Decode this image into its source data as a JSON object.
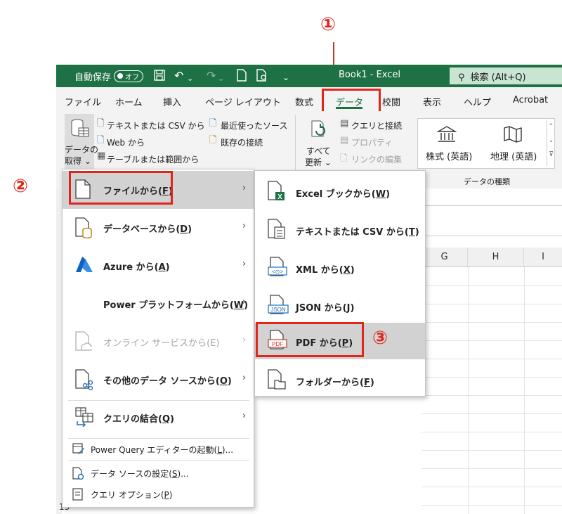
{
  "annotations": {
    "step1": "①",
    "step2": "②",
    "step3": "③"
  },
  "titlebar": {
    "autosave_label": "自動保存",
    "autosave_state": "オフ",
    "undo_icon": "↶",
    "redo_icon": "↷",
    "dropdown_glyph": "⌄",
    "book_title": "Book1  -  Excel",
    "search_text": "検索 (Alt+Q)"
  },
  "tabs": [
    "ファイル",
    "ホーム",
    "挿入",
    "ページ レイアウト",
    "数式",
    "データ",
    "校閲",
    "表示",
    "ヘルプ",
    "Acrobat"
  ],
  "ribbon": {
    "get_data_line1": "データの",
    "get_data_line2": "取得 ⌄",
    "text_csv": "テキストまたは CSV から",
    "web": "Web から",
    "table_range": "テーブルまたは範囲から",
    "recent_sources": "最近使ったソース",
    "existing_conn": "既存の接続",
    "refresh_line1": "すべて",
    "refresh_line2": "更新 ⌄",
    "queries_conn": "クエリと接続",
    "properties": "プロパティ",
    "edit_links": "リンクの編集",
    "stocks": "株式 (英語)",
    "geography": "地理 (英語)",
    "data_types_group": "データの種類"
  },
  "columns": [
    "G",
    "H",
    "I"
  ],
  "row_number": "13",
  "menu_left": {
    "from_file": "ファイルから(",
    "from_file_key": "F",
    "from_database": "データベースから(",
    "from_database_key": "D",
    "from_azure": "Azure から(",
    "from_azure_key": "A",
    "from_power_platform": "Power プラットフォームから(",
    "from_power_platform_key": "W",
    "from_online": "オンライン サービスから(E)",
    "from_other": "その他のデータ ソースから(",
    "from_other_key": "O",
    "combine_queries": "クエリの結合(",
    "combine_queries_key": "Q",
    "launch_pq": "Power Query エディターの起動(",
    "launch_pq_key": "L",
    "launch_pq_tail": ")...",
    "source_settings": "データ ソースの設定(",
    "source_settings_key": "S",
    "source_settings_tail": ")...",
    "query_options": "クエリ オプション(",
    "query_options_key": "P",
    "close_paren": ")",
    "chevron": "›"
  },
  "menu_right": {
    "excel_book": "Excel ブックから(",
    "excel_book_key": "W",
    "text_csv": "テキストまたは CSV から(",
    "text_csv_key": "T",
    "xml": "XML から(",
    "xml_key": "X",
    "json": "JSON から(",
    "json_key": "J",
    "pdf": "PDF から(",
    "pdf_key": "P",
    "folder": "フォルダーから(",
    "folder_key": "F",
    "close_paren": ")",
    "pdf_badge": "PDF",
    "json_badge": "JSON",
    "xml_badge": "<⊙>",
    "excel_badge": "X"
  },
  "colors": {
    "excel_green": "#1e7145",
    "annotation_red": "#e1251b",
    "highlight": "#d2d2d2"
  }
}
